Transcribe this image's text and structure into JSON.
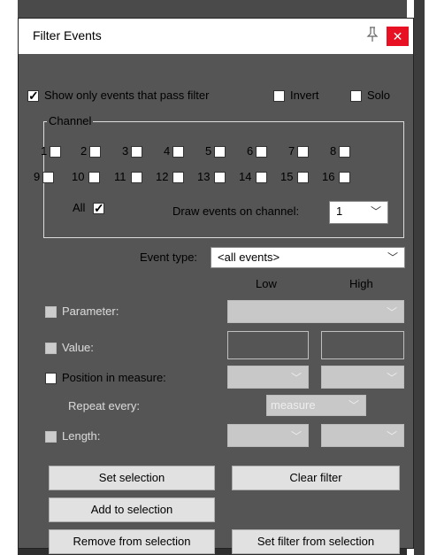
{
  "dialog": {
    "title": "Filter Events",
    "show_only_label": "Show only events that pass filter",
    "invert_label": "Invert",
    "solo_label": "Solo",
    "channel_group_title": "Channel",
    "channels": [
      "1",
      "2",
      "3",
      "4",
      "5",
      "6",
      "7",
      "8",
      "9",
      "10",
      "11",
      "12",
      "13",
      "14",
      "15",
      "16"
    ],
    "all_label": "All",
    "draw_events_label": "Draw events on channel:",
    "draw_channel_value": "1",
    "event_type_label": "Event type:",
    "event_type_value": "<all events>",
    "low_header": "Low",
    "high_header": "High",
    "parameter_label": "Parameter:",
    "value_label": "Value:",
    "position_label": "Position in measure:",
    "repeat_every_label": "Repeat every:",
    "repeat_value": "measure",
    "length_label": "Length:",
    "buttons": {
      "set_selection": "Set selection",
      "clear_filter": "Clear filter",
      "add_to_selection": "Add to selection",
      "remove_from_selection": "Remove from selection",
      "set_filter_from_selection": "Set filter from selection"
    }
  },
  "colors": {
    "dialog_bg": "#555555",
    "close_button": "#e81123"
  }
}
